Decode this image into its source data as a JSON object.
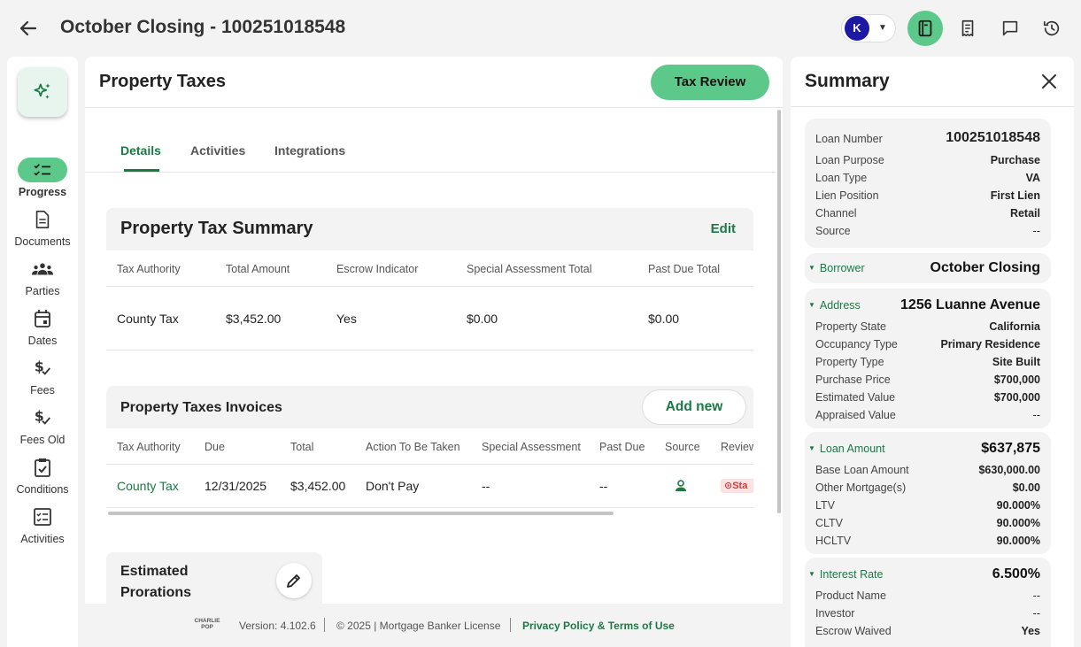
{
  "header": {
    "title": "October Closing - 100251018548",
    "avatar_initial": "K"
  },
  "rail": {
    "items": [
      {
        "label": "Progress",
        "icon": "checklist-icon"
      },
      {
        "label": "Documents",
        "icon": "document-icon"
      },
      {
        "label": "Parties",
        "icon": "people-icon"
      },
      {
        "label": "Dates",
        "icon": "calendar-icon"
      },
      {
        "label": "Fees",
        "icon": "dollar-check-icon"
      },
      {
        "label": "Fees Old",
        "icon": "dollar-check-icon"
      },
      {
        "label": "Conditions",
        "icon": "clipboard-check-icon"
      },
      {
        "label": "Activities",
        "icon": "checklist-box-icon"
      }
    ]
  },
  "main": {
    "title": "Property Taxes",
    "tax_review_label": "Tax Review",
    "tabs": [
      {
        "label": "Details"
      },
      {
        "label": "Activities"
      },
      {
        "label": "Integrations"
      }
    ],
    "summary_card": {
      "title": "Property Tax Summary",
      "edit_label": "Edit",
      "columns": [
        "Tax Authority",
        "Total Amount",
        "Escrow Indicator",
        "Special Assessment Total",
        "Past Due Total"
      ],
      "row": [
        "County Tax",
        "$3,452.00",
        "Yes",
        "$0.00",
        "$0.00"
      ]
    },
    "invoices_card": {
      "title": "Property Taxes Invoices",
      "add_new_label": "Add new",
      "columns": [
        "Tax Authority",
        "Due",
        "Total",
        "Action To Be Taken",
        "Special Assessment",
        "Past Due",
        "Source",
        "Review"
      ],
      "row": {
        "authority": "County Tax",
        "due": "12/31/2025",
        "total": "$3,452.00",
        "action": "Don't Pay",
        "special": "--",
        "past_due": "--",
        "status": "Sta"
      }
    },
    "prorations": {
      "title": "Estimated Prorations"
    }
  },
  "footer": {
    "logo_line1": "CHARLIE",
    "logo_line2": "POP",
    "version": "Version: 4.102.6",
    "license": "© 2025 | Mortgage Banker License",
    "privacy": "Privacy Policy & Terms of Use"
  },
  "summary": {
    "title": "Summary",
    "loan": {
      "loan_number_label": "Loan Number",
      "loan_number": "100251018548",
      "purpose_label": "Loan Purpose",
      "purpose": "Purchase",
      "type_label": "Loan Type",
      "type": "VA",
      "lien_label": "Lien Position",
      "lien": "First Lien",
      "channel_label": "Channel",
      "channel": "Retail",
      "source_label": "Source",
      "source": "--"
    },
    "borrower": {
      "label": "Borrower",
      "value": "October Closing"
    },
    "address": {
      "label": "Address",
      "value": "1256 Luanne Avenue",
      "rows": [
        {
          "k": "Property State",
          "v": "California"
        },
        {
          "k": "Occupancy Type",
          "v": "Primary Residence"
        },
        {
          "k": "Property Type",
          "v": "Site Built"
        },
        {
          "k": "Purchase Price",
          "v": "$700,000"
        },
        {
          "k": "Estimated Value",
          "v": "$700,000"
        },
        {
          "k": "Appraised Value",
          "v": "--"
        }
      ]
    },
    "loan_amount": {
      "label": "Loan Amount",
      "value": "$637,875",
      "rows": [
        {
          "k": "Base Loan Amount",
          "v": "$630,000.00"
        },
        {
          "k": "Other Mortgage(s)",
          "v": "$0.00"
        },
        {
          "k": "LTV",
          "v": "90.000%"
        },
        {
          "k": "CLTV",
          "v": "90.000%"
        },
        {
          "k": "HCLTV",
          "v": "90.000%"
        }
      ]
    },
    "interest_rate": {
      "label": "Interest Rate",
      "value": "6.500%",
      "rows": [
        {
          "k": "Product Name",
          "v": "--"
        },
        {
          "k": "Investor",
          "v": "--"
        },
        {
          "k": "Escrow Waived",
          "v": "Yes"
        }
      ]
    }
  },
  "colors": {
    "accent": "#5cc98a",
    "link": "#1a7a44",
    "avatar": "#1c1aa5",
    "status": "#d23a3a"
  }
}
